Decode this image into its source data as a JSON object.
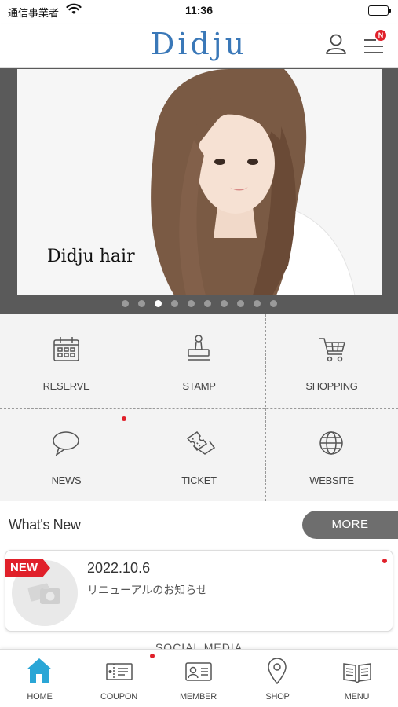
{
  "status_bar": {
    "carrier": "通信事業者",
    "time": "11:36"
  },
  "header": {
    "logo": "Didju",
    "menu_badge": "N"
  },
  "hero": {
    "caption": "Didju hair",
    "slide_count": 10,
    "active_slide": 3
  },
  "grid": {
    "items": [
      {
        "label": "RESERVE",
        "icon": "calendar-icon"
      },
      {
        "label": "STAMP",
        "icon": "stamp-icon"
      },
      {
        "label": "SHOPPING",
        "icon": "cart-icon"
      },
      {
        "label": "NEWS",
        "icon": "speech-bubble-icon"
      },
      {
        "label": "TICKET",
        "icon": "ticket-icon"
      },
      {
        "label": "WEBSITE",
        "icon": "globe-icon"
      }
    ]
  },
  "whats_new": {
    "title": "What's New",
    "more_label": "MORE",
    "items": [
      {
        "tag": "NEW",
        "date": "2022.10.6",
        "text": "リニューアルのお知らせ"
      }
    ]
  },
  "social_heading": "SOCIAL MEDIA",
  "tabbar": {
    "tabs": [
      {
        "label": "HOME",
        "icon": "home-icon"
      },
      {
        "label": "COUPON",
        "icon": "coupon-icon"
      },
      {
        "label": "MEMBER",
        "icon": "member-card-icon"
      },
      {
        "label": "SHOP",
        "icon": "location-pin-icon"
      },
      {
        "label": "MENU",
        "icon": "book-icon"
      }
    ]
  },
  "colors": {
    "accent": "#3a78b8",
    "home_active": "#2aa6d6",
    "badge_red": "#e0202a",
    "more_button": "#6e6e6e"
  }
}
